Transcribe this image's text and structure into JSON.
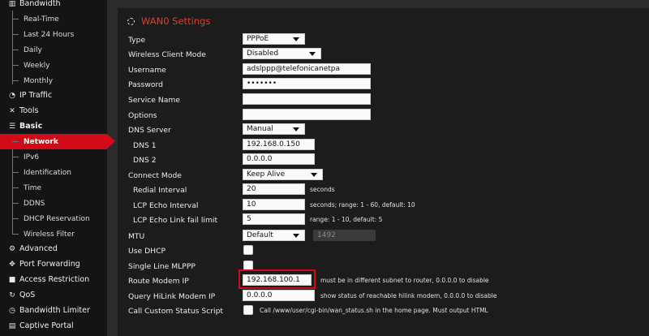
{
  "sidebar": {
    "bandwidth": "Bandwidth",
    "bandwidth_items": [
      "Real-Time",
      "Last 24 Hours",
      "Daily",
      "Weekly",
      "Monthly"
    ],
    "ip_traffic": "IP Traffic",
    "tools": "Tools",
    "basic": "Basic",
    "basic_items": [
      "Network",
      "IPv6",
      "Identification",
      "Time",
      "DDNS",
      "DHCP Reservation",
      "Wireless Filter"
    ],
    "advanced": "Advanced",
    "port_forwarding": "Port Forwarding",
    "access_restriction": "Access Restriction",
    "qos": "QoS",
    "bandwidth_limiter": "Bandwidth Limiter",
    "captive_portal": "Captive Portal",
    "active_item": "Network"
  },
  "panel": {
    "title": "WAN0 Settings",
    "fields": {
      "type": {
        "label": "Type",
        "value": "PPPoE"
      },
      "wireless_client_mode": {
        "label": "Wireless Client Mode",
        "value": "Disabled"
      },
      "username": {
        "label": "Username",
        "value": "adslppp@telefonicanetpa"
      },
      "password": {
        "label": "Password",
        "value": "•••••••"
      },
      "service_name": {
        "label": "Service Name",
        "value": ""
      },
      "options": {
        "label": "Options",
        "value": ""
      },
      "dns_server": {
        "label": "DNS Server",
        "value": "Manual"
      },
      "dns1": {
        "label": "DNS 1",
        "value": "192.168.0.150"
      },
      "dns2": {
        "label": "DNS 2",
        "value": "0.0.0.0"
      },
      "connect_mode": {
        "label": "Connect Mode",
        "value": "Keep Alive"
      },
      "redial_interval": {
        "label": "Redial Interval",
        "value": "20",
        "hint": "seconds"
      },
      "lcp_echo_interval": {
        "label": "LCP Echo Interval",
        "value": "10",
        "hint": "seconds; range: 1 - 60, default: 10"
      },
      "lcp_echo_fail": {
        "label": "LCP Echo Link fail limit",
        "value": "5",
        "hint": "range: 1 - 10, default: 5"
      },
      "mtu": {
        "label": "MTU",
        "value": "Default",
        "extra": "1492"
      },
      "use_dhcp": {
        "label": "Use DHCP"
      },
      "single_line_mlppp": {
        "label": "Single Line MLPPP"
      },
      "route_modem_ip": {
        "label": "Route Modem IP",
        "value": "192.168.100.1",
        "hint": "must be in different subnet to router, 0.0.0.0 to disable"
      },
      "query_hilink": {
        "label": "Query HiLink Modem IP",
        "value": "0.0.0.0",
        "hint": "show status of reachable hilink modem, 0.0.0.0 to disable"
      },
      "custom_status": {
        "label": "Call Custom Status Script",
        "hint": "Call /www/user/cgi-bin/wan_status.sh in the home page. Must output HTML"
      }
    }
  },
  "colors": {
    "accent": "#d10a1a",
    "title": "#e53935",
    "panel": "#1c1c1c",
    "sidebar": "#141414"
  }
}
